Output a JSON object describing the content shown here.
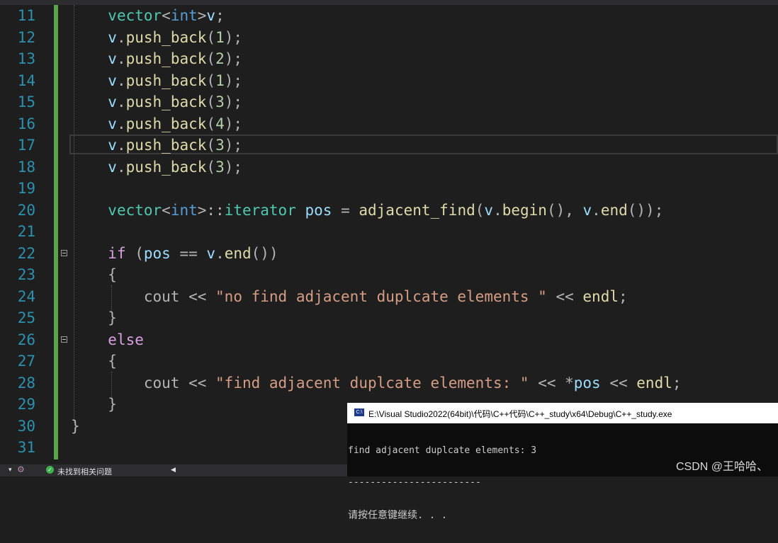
{
  "editor": {
    "lines": [
      {
        "num": "11",
        "tokens": [
          {
            "t": "vector",
            "c": "ty"
          },
          {
            "t": "<",
            "c": "op"
          },
          {
            "t": "int",
            "c": "kw"
          },
          {
            "t": ">",
            "c": "op"
          },
          {
            "t": "v",
            "c": "var"
          },
          {
            "t": ";",
            "c": "op"
          }
        ]
      },
      {
        "num": "12",
        "tokens": [
          {
            "t": "v",
            "c": "var"
          },
          {
            "t": ".",
            "c": "op"
          },
          {
            "t": "push_back",
            "c": "fn"
          },
          {
            "t": "(",
            "c": "op"
          },
          {
            "t": "1",
            "c": "num"
          },
          {
            "t": ");",
            "c": "op"
          }
        ]
      },
      {
        "num": "13",
        "tokens": [
          {
            "t": "v",
            "c": "var"
          },
          {
            "t": ".",
            "c": "op"
          },
          {
            "t": "push_back",
            "c": "fn"
          },
          {
            "t": "(",
            "c": "op"
          },
          {
            "t": "2",
            "c": "num"
          },
          {
            "t": ");",
            "c": "op"
          }
        ]
      },
      {
        "num": "14",
        "tokens": [
          {
            "t": "v",
            "c": "var"
          },
          {
            "t": ".",
            "c": "op"
          },
          {
            "t": "push_back",
            "c": "fn"
          },
          {
            "t": "(",
            "c": "op"
          },
          {
            "t": "1",
            "c": "num"
          },
          {
            "t": ");",
            "c": "op"
          }
        ]
      },
      {
        "num": "15",
        "tokens": [
          {
            "t": "v",
            "c": "var"
          },
          {
            "t": ".",
            "c": "op"
          },
          {
            "t": "push_back",
            "c": "fn"
          },
          {
            "t": "(",
            "c": "op"
          },
          {
            "t": "3",
            "c": "num"
          },
          {
            "t": ");",
            "c": "op"
          }
        ]
      },
      {
        "num": "16",
        "tokens": [
          {
            "t": "v",
            "c": "var"
          },
          {
            "t": ".",
            "c": "op"
          },
          {
            "t": "push_back",
            "c": "fn"
          },
          {
            "t": "(",
            "c": "op"
          },
          {
            "t": "4",
            "c": "num"
          },
          {
            "t": ");",
            "c": "op"
          }
        ]
      },
      {
        "num": "17",
        "tokens": [
          {
            "t": "v",
            "c": "var"
          },
          {
            "t": ".",
            "c": "op"
          },
          {
            "t": "push_back",
            "c": "fn"
          },
          {
            "t": "(",
            "c": "op"
          },
          {
            "t": "3",
            "c": "num"
          },
          {
            "t": ");",
            "c": "op"
          }
        ]
      },
      {
        "num": "18",
        "tokens": [
          {
            "t": "v",
            "c": "var"
          },
          {
            "t": ".",
            "c": "op"
          },
          {
            "t": "push_back",
            "c": "fn"
          },
          {
            "t": "(",
            "c": "op"
          },
          {
            "t": "3",
            "c": "num"
          },
          {
            "t": ");",
            "c": "op"
          }
        ]
      },
      {
        "num": "19",
        "tokens": []
      },
      {
        "num": "20",
        "tokens": [
          {
            "t": "vector",
            "c": "ty"
          },
          {
            "t": "<",
            "c": "op"
          },
          {
            "t": "int",
            "c": "kw"
          },
          {
            "t": ">::",
            "c": "op"
          },
          {
            "t": "iterator",
            "c": "ty"
          },
          {
            "t": " ",
            "c": "op"
          },
          {
            "t": "pos",
            "c": "var"
          },
          {
            "t": " = ",
            "c": "op"
          },
          {
            "t": "adjacent_find",
            "c": "fn"
          },
          {
            "t": "(",
            "c": "op"
          },
          {
            "t": "v",
            "c": "var"
          },
          {
            "t": ".",
            "c": "op"
          },
          {
            "t": "begin",
            "c": "fn"
          },
          {
            "t": "(), ",
            "c": "op"
          },
          {
            "t": "v",
            "c": "var"
          },
          {
            "t": ".",
            "c": "op"
          },
          {
            "t": "end",
            "c": "fn"
          },
          {
            "t": "());",
            "c": "op"
          }
        ]
      },
      {
        "num": "21",
        "tokens": []
      },
      {
        "num": "22",
        "tokens": [
          {
            "t": "if",
            "c": "ctl"
          },
          {
            "t": " (",
            "c": "op"
          },
          {
            "t": "pos",
            "c": "var"
          },
          {
            "t": " == ",
            "c": "op"
          },
          {
            "t": "v",
            "c": "var"
          },
          {
            "t": ".",
            "c": "op"
          },
          {
            "t": "end",
            "c": "fn"
          },
          {
            "t": "())",
            "c": "op"
          }
        ]
      },
      {
        "num": "23",
        "tokens": [
          {
            "t": "{",
            "c": "op"
          }
        ]
      },
      {
        "num": "24",
        "tokens": [
          {
            "t": "    cout",
            "c": "op"
          },
          {
            "t": " << ",
            "c": "op"
          },
          {
            "t": "\"no find adjacent duplcate elements \"",
            "c": "str"
          },
          {
            "t": " << ",
            "c": "op"
          },
          {
            "t": "endl",
            "c": "fn"
          },
          {
            "t": ";",
            "c": "op"
          }
        ]
      },
      {
        "num": "25",
        "tokens": [
          {
            "t": "}",
            "c": "op"
          }
        ]
      },
      {
        "num": "26",
        "tokens": [
          {
            "t": "else",
            "c": "ctl"
          }
        ]
      },
      {
        "num": "27",
        "tokens": [
          {
            "t": "{",
            "c": "op"
          }
        ]
      },
      {
        "num": "28",
        "tokens": [
          {
            "t": "    cout",
            "c": "op"
          },
          {
            "t": " << ",
            "c": "op"
          },
          {
            "t": "\"find adjacent duplcate elements: \"",
            "c": "str"
          },
          {
            "t": " << *",
            "c": "op"
          },
          {
            "t": "pos",
            "c": "var"
          },
          {
            "t": " << ",
            "c": "op"
          },
          {
            "t": "endl",
            "c": "fn"
          },
          {
            "t": ";",
            "c": "op"
          }
        ]
      },
      {
        "num": "29",
        "tokens": [
          {
            "t": "}",
            "c": "op"
          }
        ]
      },
      {
        "num": "30",
        "tokens": [
          {
            "t": "}",
            "c": "op"
          }
        ]
      },
      {
        "num": "31",
        "tokens": []
      }
    ],
    "current_line": "17",
    "gutter_color": "#57a64a"
  },
  "status": {
    "issues_label": "未找到相关问题",
    "issues_icon": "check-circle-icon"
  },
  "console": {
    "title": "E:\\Visual Studio2022(64bit)\\代码\\C++代码\\C++_study\\x64\\Debug\\C++_study.exe",
    "output_line1": "find adjacent duplcate elements: 3",
    "output_line2": "------------------------",
    "output_line3": "请按任意键继续. . .",
    "watermark": "CSDN @王哈哈、"
  }
}
